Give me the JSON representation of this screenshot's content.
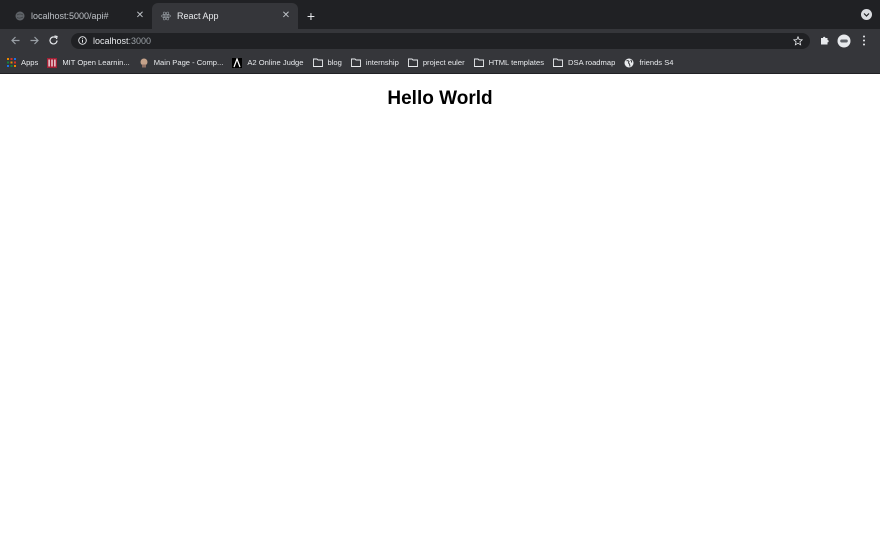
{
  "tabs": [
    {
      "title": "localhost:5000/api#",
      "favicon": "globe-icon",
      "active": false
    },
    {
      "title": "React App",
      "favicon": "react-icon",
      "active": true
    }
  ],
  "omnibox": {
    "host": "localhost",
    "port": ":3000"
  },
  "bookmarks": [
    {
      "label": "Apps",
      "icon": "apps-grid-icon"
    },
    {
      "label": "MIT Open Learnin...",
      "icon": "mit-icon"
    },
    {
      "label": "Main Page - Comp...",
      "icon": "site-icon"
    },
    {
      "label": "A2 Online Judge",
      "icon": "a2-icon"
    },
    {
      "label": "blog",
      "icon": "folder-icon"
    },
    {
      "label": "internship",
      "icon": "folder-icon"
    },
    {
      "label": "project euler",
      "icon": "folder-icon"
    },
    {
      "label": "HTML templates",
      "icon": "folder-icon"
    },
    {
      "label": "DSA roadmap",
      "icon": "folder-icon"
    },
    {
      "label": "friends S4",
      "icon": "globe-icon"
    }
  ],
  "page": {
    "heading": "Hello World"
  },
  "colors": {
    "chrome_dark": "#202124",
    "toolbar": "#35363a",
    "text_light": "#e8eaed"
  }
}
